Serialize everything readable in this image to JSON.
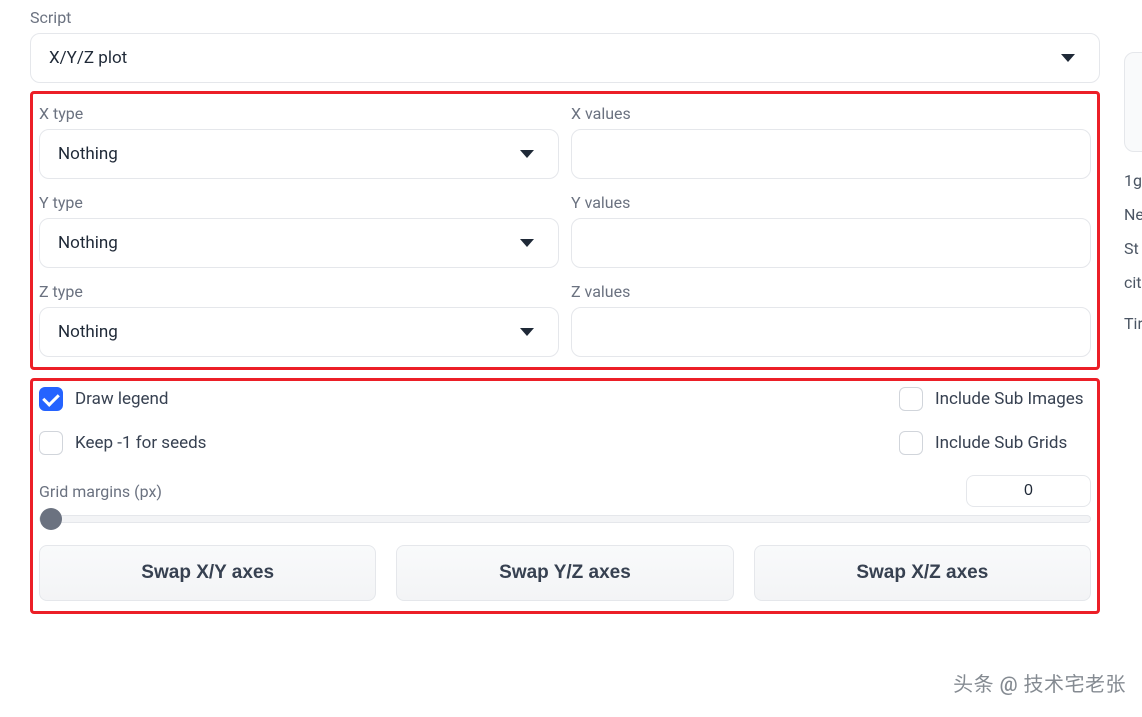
{
  "script": {
    "label": "Script",
    "value": "X/Y/Z plot"
  },
  "axes": {
    "x": {
      "type_label": "X type",
      "type_value": "Nothing",
      "values_label": "X values",
      "values_value": ""
    },
    "y": {
      "type_label": "Y type",
      "type_value": "Nothing",
      "values_label": "Y values",
      "values_value": ""
    },
    "z": {
      "type_label": "Z type",
      "type_value": "Nothing",
      "values_label": "Z values",
      "values_value": ""
    }
  },
  "options": {
    "draw_legend": {
      "label": "Draw legend",
      "checked": true
    },
    "keep_seed": {
      "label": "Keep -1 for seeds",
      "checked": false
    },
    "include_sub_images": {
      "label": "Include Sub Images",
      "checked": false
    },
    "include_sub_grids": {
      "label": "Include Sub Grids",
      "checked": false
    }
  },
  "grid_margins": {
    "label": "Grid margins (px)",
    "value": "0"
  },
  "buttons": {
    "swap_xy": "Swap X/Y axes",
    "swap_yz": "Swap Y/Z axes",
    "swap_xz": "Swap X/Z axes"
  },
  "sidebar_peek": {
    "l1": "1g",
    "l2": "Ne",
    "l3": "St",
    "l4": "cit",
    "l5": "Tir"
  },
  "watermark": "头条 @ 技术宅老张"
}
